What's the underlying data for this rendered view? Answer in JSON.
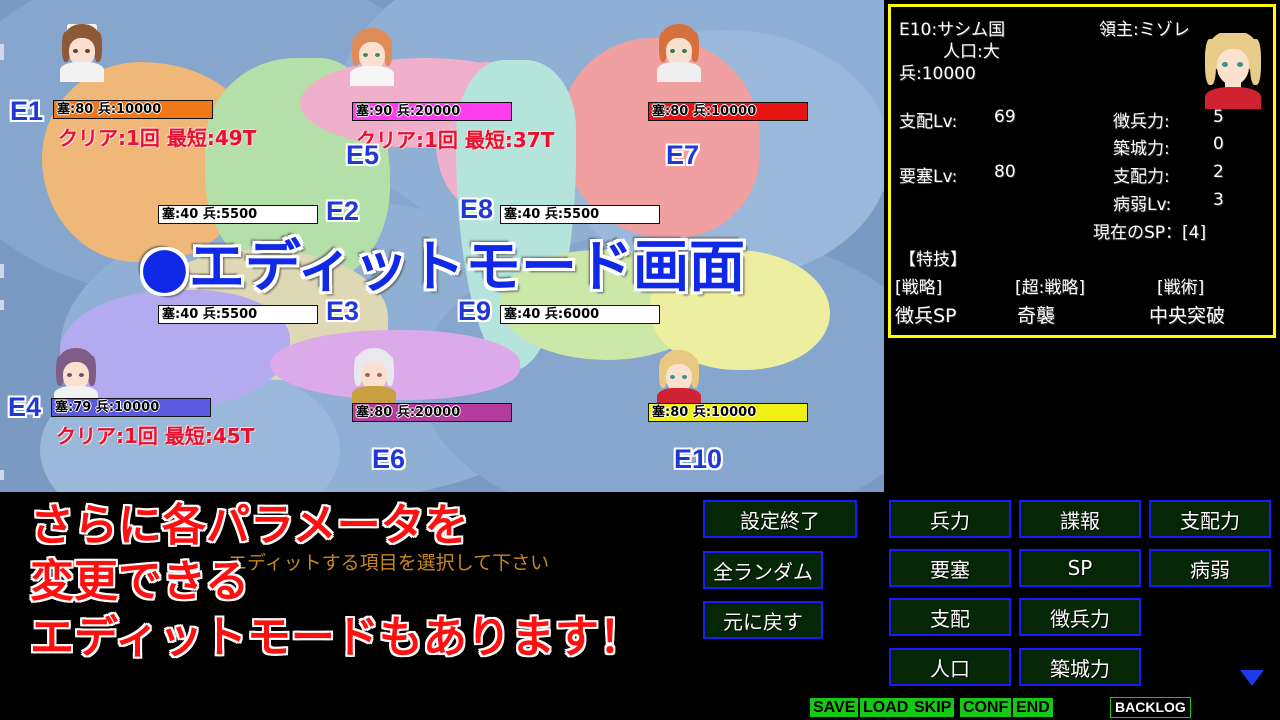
{
  "overlay": {
    "edit_mode_title": "●エディットモード画面",
    "annotation_lines": [
      "さらに各パラメータを",
      "変更できる",
      "エディットモードもあります！"
    ]
  },
  "game_message": "エディットする項目を選択して下さい",
  "map": {
    "regions": [
      {
        "id": "E1",
        "fort_label": "塞:80",
        "troops_label": "兵:10000",
        "fort": 80,
        "troops": 10000,
        "bar_color": "#f07818",
        "bar_fill_pct": 100,
        "clear_text": "クリア:1回  最短:49T",
        "territory_color": "#f0b878"
      },
      {
        "id": "E2",
        "fort_label": "塞:40",
        "troops_label": "兵:5500",
        "fort": 40,
        "troops": 5500,
        "bar_color": "#ffffff",
        "bar_fill_pct": 0,
        "clear_text": "",
        "territory_color": "#b4dfa8"
      },
      {
        "id": "E3",
        "fort_label": "塞:40",
        "troops_label": "兵:5500",
        "fort": 40,
        "troops": 5500,
        "bar_color": "#ffffff",
        "bar_fill_pct": 0,
        "clear_text": "",
        "territory_color": "#ded8b4"
      },
      {
        "id": "E4",
        "fort_label": "塞:79",
        "troops_label": "兵:10000",
        "fort": 79,
        "troops": 10000,
        "bar_color": "#5a5ae0",
        "bar_fill_pct": 100,
        "clear_text": "クリア:1回  最短:45T",
        "territory_color": "#b4aaf0"
      },
      {
        "id": "E5",
        "fort_label": "塞:90",
        "troops_label": "兵:20000",
        "fort": 90,
        "troops": 20000,
        "bar_color": "#ff3cf0",
        "bar_fill_pct": 100,
        "clear_text": "クリア:1回  最短:37T",
        "territory_color": "#f0b0cc"
      },
      {
        "id": "E6",
        "fort_label": "塞:80",
        "troops_label": "兵:20000",
        "fort": 80,
        "troops": 20000,
        "bar_color": "#b43c9c",
        "bar_fill_pct": 100,
        "clear_text": "",
        "territory_color": "#dcaae8"
      },
      {
        "id": "E7",
        "fort_label": "塞:80",
        "troops_label": "兵:10000",
        "fort": 80,
        "troops": 10000,
        "bar_color": "#e81414",
        "bar_fill_pct": 100,
        "clear_text": "",
        "territory_color": "#f0a0a0"
      },
      {
        "id": "E8",
        "fort_label": "塞:40",
        "troops_label": "兵:5500",
        "fort": 40,
        "troops": 5500,
        "bar_color": "#ffffff",
        "bar_fill_pct": 0,
        "clear_text": "",
        "territory_color": "#b4e4dc"
      },
      {
        "id": "E9",
        "fort_label": "塞:40",
        "troops_label": "兵:6000",
        "fort": 40,
        "troops": 6000,
        "bar_color": "#ffffff",
        "bar_fill_pct": 0,
        "clear_text": "",
        "territory_color": "#cce8a8"
      },
      {
        "id": "E10",
        "fort_label": "塞:80",
        "troops_label": "兵:10000",
        "fort": 80,
        "troops": 10000,
        "bar_color": "#f0f014",
        "bar_fill_pct": 100,
        "clear_text": "",
        "territory_color": "#eeeea0"
      }
    ]
  },
  "info_panel": {
    "region_name": "E10:サシム国",
    "lord": "領主:ミゾレ",
    "population": "人口:大",
    "troops": "兵:10000",
    "rule_lv": {
      "label": "支配Lv:",
      "value": "69"
    },
    "fort_lv": {
      "label": "要塞Lv:",
      "value": "80"
    },
    "conscript": {
      "label": "徴兵力:",
      "value": "5"
    },
    "build": {
      "label": "築城力:",
      "value": "0"
    },
    "rule_power": {
      "label": "支配力:",
      "value": "2"
    },
    "sick_lv": {
      "label": "病弱Lv:",
      "value": "3"
    },
    "current_sp": "現在のSP：[4]",
    "skills_header": "【特技】",
    "skill_categories": [
      "[戦略]",
      "[超:戦略]",
      "[戦術]"
    ],
    "skill_names": [
      "徴兵SP",
      "奇襲",
      "中央突破"
    ],
    "border_color": "#ffff00"
  },
  "left_buttons": [
    {
      "label": "設定終了"
    },
    {
      "label": "全ランダム"
    },
    {
      "label": "元に戻す"
    }
  ],
  "param_buttons": [
    {
      "label": "兵力"
    },
    {
      "label": "諜報"
    },
    {
      "label": "支配力"
    },
    {
      "label": "要塞"
    },
    {
      "label": "SP"
    },
    {
      "label": "病弱"
    },
    {
      "label": "支配"
    },
    {
      "label": "徴兵力"
    },
    {
      "label": "人口"
    },
    {
      "label": "築城力"
    }
  ],
  "status_bar": {
    "buttons": [
      "SAVE",
      "LOAD",
      "SKIP",
      "CONF",
      "END"
    ],
    "backlog": "BACKLOG",
    "accent": "#14c814"
  }
}
